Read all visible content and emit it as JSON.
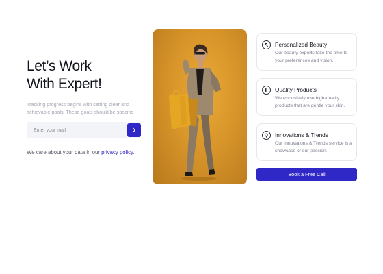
{
  "hero": {
    "headline_line1": "Let’s Work",
    "headline_line2": "With Expert!",
    "description": "Tracking progress begins with setting clear and achievable goals. These goals should be specific"
  },
  "email_form": {
    "placeholder": "Enter your mail",
    "value": "",
    "submit_icon": "chevron-right-icon"
  },
  "privacy": {
    "text": "We care about your data in our ",
    "link_label": "privacy policy."
  },
  "features": [
    {
      "icon": "arrow-up-left-icon",
      "title": "Personalized Beauty",
      "text": "Our beauty experts take the time to your preferences and vision."
    },
    {
      "icon": "half-circle-icon",
      "title": "Quality Products",
      "text": "We exclusively use high-quality products that are gentle your skin."
    },
    {
      "icon": "lightbulb-icon",
      "title": "Innovations & Trends",
      "text": "Our Innovations & Trends service is a showcase of our passion."
    }
  ],
  "cta": {
    "label": "Book a Free Call"
  },
  "colors": {
    "accent": "#2f27c6",
    "photo_background": "#d8952a",
    "text_primary": "#14161f",
    "text_muted": "#a4a8b3"
  }
}
